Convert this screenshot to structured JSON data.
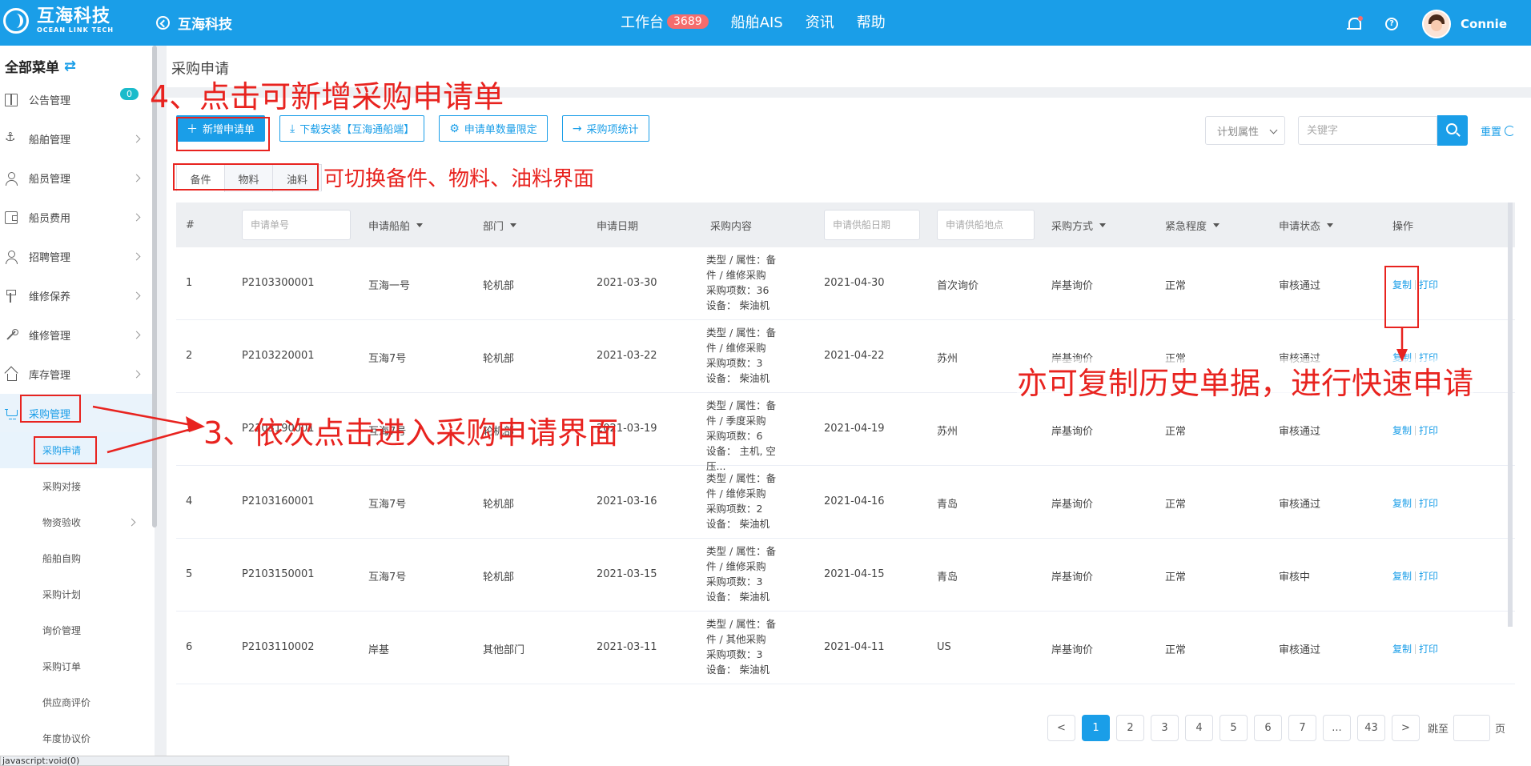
{
  "header": {
    "logo_cn": "互海科技",
    "logo_en": "OCEAN LINK TECH",
    "back_label": "互海科技",
    "nav": [
      {
        "label": "工作台",
        "badge": "3689"
      },
      {
        "label": "船舶AIS"
      },
      {
        "label": "资讯"
      },
      {
        "label": "帮助"
      }
    ],
    "username": "Connie"
  },
  "sidebar": {
    "title": "全部菜单",
    "items": [
      {
        "label": "公告管理",
        "icon": "book-icon",
        "badge": "0"
      },
      {
        "label": "船舶管理",
        "icon": "anchor-icon"
      },
      {
        "label": "船员管理",
        "icon": "user-icon"
      },
      {
        "label": "船员费用",
        "icon": "wallet-icon"
      },
      {
        "label": "招聘管理",
        "icon": "user-icon"
      },
      {
        "label": "维修保养",
        "icon": "tool-icon"
      },
      {
        "label": "维修管理",
        "icon": "wrench-icon"
      },
      {
        "label": "库存管理",
        "icon": "home-icon"
      },
      {
        "label": "采购管理",
        "icon": "cart-icon"
      }
    ],
    "sub_items": [
      {
        "label": "采购申请"
      },
      {
        "label": "采购对接"
      },
      {
        "label": "物资验收"
      },
      {
        "label": "船舶自购"
      },
      {
        "label": "采购计划"
      },
      {
        "label": "询价管理"
      },
      {
        "label": "采购订单"
      },
      {
        "label": "供应商评价"
      },
      {
        "label": "年度协议价"
      }
    ]
  },
  "breadcrumb": "采购申请",
  "toolbar": {
    "add": "新增申请单",
    "download": "下载安装【互海通船端】",
    "limit": "申请单数量限定",
    "stats": "采购项统计",
    "filter_select": "计划属性",
    "keyword_placeholder": "关键字",
    "reset": "重置"
  },
  "tabs": [
    "备件",
    "物料",
    "油料"
  ],
  "table": {
    "headers": {
      "index": "#",
      "order_no_placeholder": "申请单号",
      "ship": "申请船舶",
      "dept": "部门",
      "date": "申请日期",
      "content": "采购内容",
      "supply_date_placeholder": "申请供船日期",
      "supply_place_placeholder": "申请供船地点",
      "method": "采购方式",
      "urgency": "紧急程度",
      "status": "申请状态",
      "ops": "操作"
    },
    "rows": [
      {
        "idx": "1",
        "no": "P2103300001",
        "ship": "互海一号",
        "dept": "轮机部",
        "date": "2021-03-30",
        "content": [
          "类型 / 属性：备",
          "件 / 维修采购",
          "采购项数：36",
          "设备： 柴油机"
        ],
        "supply_date": "2021-04-30",
        "place": "首次询价",
        "method": "岸基询价",
        "urgency": "正常",
        "status": "审核通过",
        "copy": "复制",
        "print": "打印"
      },
      {
        "idx": "2",
        "no": "P2103220001",
        "ship": "互海7号",
        "dept": "轮机部",
        "date": "2021-03-22",
        "content": [
          "类型 / 属性：备",
          "件 / 维修采购",
          "采购项数：3",
          "设备： 柴油机"
        ],
        "supply_date": "2021-04-22",
        "place": "苏州",
        "method": "岸基询价",
        "urgency": "正常",
        "status": "审核通过",
        "copy": "复制",
        "print": "打印"
      },
      {
        "idx": "3",
        "no": "P2103190001",
        "ship": "互海7号",
        "dept": "轮机部",
        "date": "2021-03-19",
        "content": [
          "类型 / 属性：备",
          "件 / 季度采购",
          "采购项数：6",
          "设备： 主机, 空压..."
        ],
        "supply_date": "2021-04-19",
        "place": "苏州",
        "method": "岸基询价",
        "urgency": "正常",
        "status": "审核通过",
        "copy": "复制",
        "print": "打印"
      },
      {
        "idx": "4",
        "no": "P2103160001",
        "ship": "互海7号",
        "dept": "轮机部",
        "date": "2021-03-16",
        "content": [
          "类型 / 属性：备",
          "件 / 维修采购",
          "采购项数：2",
          "设备： 柴油机"
        ],
        "supply_date": "2021-04-16",
        "place": "青岛",
        "method": "岸基询价",
        "urgency": "正常",
        "status": "审核通过",
        "copy": "复制",
        "print": "打印"
      },
      {
        "idx": "5",
        "no": "P2103150001",
        "ship": "互海7号",
        "dept": "轮机部",
        "date": "2021-03-15",
        "content": [
          "类型 / 属性：备",
          "件 / 维修采购",
          "采购项数：3",
          "设备： 柴油机"
        ],
        "supply_date": "2021-04-15",
        "place": "青岛",
        "method": "岸基询价",
        "urgency": "正常",
        "status": "审核中",
        "copy": "复制",
        "print": "打印"
      },
      {
        "idx": "6",
        "no": "P2103110002",
        "ship": "岸基",
        "dept": "其他部门",
        "date": "2021-03-11",
        "content": [
          "类型 / 属性：备",
          "件 / 其他采购",
          "采购项数：3",
          "设备： 柴油机"
        ],
        "supply_date": "2021-04-11",
        "place": "US",
        "method": "岸基询价",
        "urgency": "正常",
        "status": "审核通过",
        "copy": "复制",
        "print": "打印"
      }
    ]
  },
  "pagination": {
    "prev": "<",
    "pages": [
      "1",
      "2",
      "3",
      "4",
      "5",
      "6",
      "7",
      "...",
      "43"
    ],
    "next": ">",
    "jump_label": "跳至",
    "page_label": "页"
  },
  "status_url": "javascript:void(0)",
  "annotations": {
    "step4": "4、点击可新增采购申请单",
    "tabs_hint": "可切换备件、物料、油料界面",
    "step3": "3、依次点击进入采购申请界面",
    "copy_hint": "亦可复制历史单据，进行快速申请"
  },
  "colors": {
    "primary": "#1a9ee8",
    "annotation": "#e8231f",
    "badge": "#f56c6c"
  }
}
